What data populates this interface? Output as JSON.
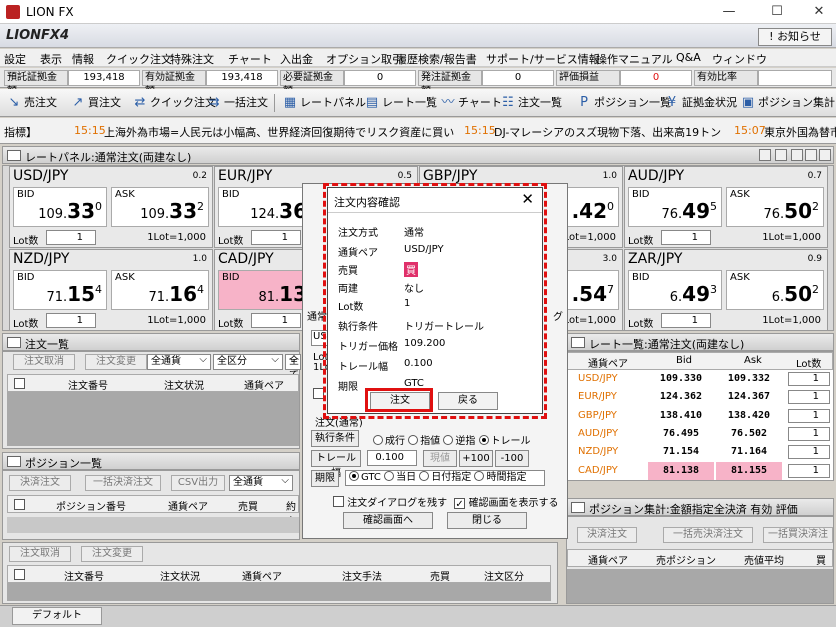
{
  "window": {
    "title": "LION FX",
    "min": "—",
    "max": "☐",
    "close": "✕"
  },
  "brand": {
    "name": "LIONFX4",
    "notice": "! お知らせ"
  },
  "menu": [
    "設定",
    "表示",
    "情報",
    "クイック注文",
    "特殊注文",
    "チャート",
    "入出金",
    "オプション取引",
    "履歴検索/報告書",
    "サポート/サービス情報",
    "操作マニュアル",
    "Q&A",
    "ウィンドウ"
  ],
  "status": [
    {
      "label": "預託証拠金額",
      "value": "193,418"
    },
    {
      "label": "有効証拠金額",
      "value": "193,418"
    },
    {
      "label": "必要証拠金額",
      "value": "0"
    },
    {
      "label": "発注証拠金額",
      "value": "0"
    },
    {
      "label": "評価損益",
      "value": "0"
    },
    {
      "label": "有効比率",
      "value": ""
    }
  ],
  "toolbar": [
    "売注文",
    "買注文",
    "クイック注文",
    "一括注文",
    "レートパネル",
    "レート一覧",
    "チャート",
    "注文一覧",
    "ポジション一覧",
    "証拠金状況",
    "ポジション集計"
  ],
  "ticker": {
    "prefix": "指標】",
    "items": [
      {
        "time": "15:15",
        "text": "上海外為市場=人民元は小幅高、世界経済回復期待でリスク資産に買い"
      },
      {
        "time": "15:15",
        "text": "DJ-マレーシアのスズ現物下落、出来高19トン"
      },
      {
        "time": "15:07",
        "text": "東京外国為替市"
      }
    ]
  },
  "rate_panel": {
    "title": "レートパネル:通常注文(両建なし)",
    "bid_label": "BID",
    "ask_label": "ASK",
    "lot_label": "Lot数",
    "lot_value": "1",
    "lot_unit": "1Lot=1,000",
    "pairs": [
      {
        "pair": "USD/JPY",
        "spread": "0.2",
        "bid_main": "109.",
        "bid_big": "33",
        "bid_small": "0",
        "ask_main": "109.",
        "ask_big": "33",
        "ask_small": "2"
      },
      {
        "pair": "EUR/JPY",
        "spread": "0.5",
        "bid_main": "124.",
        "bid_big": "36",
        "bid_small": "",
        "ask_main": "",
        "ask_big": "",
        "ask_small": ""
      },
      {
        "pair": "GBP/JPY",
        "spread": "1.0",
        "bid_main": "",
        "bid_big": "",
        "bid_small": "",
        "ask_main": "",
        "ask_big": ".42",
        "ask_small": "0"
      },
      {
        "pair": "AUD/JPY",
        "spread": "0.7",
        "bid_main": "76.",
        "bid_big": "49",
        "bid_small": "5",
        "ask_main": "76.",
        "ask_big": "50",
        "ask_small": "2"
      },
      {
        "pair": "NZD/JPY",
        "spread": "1.0",
        "bid_main": "71.",
        "bid_big": "15",
        "bid_small": "4",
        "ask_main": "71.",
        "ask_big": "16",
        "ask_small": "4"
      },
      {
        "pair": "CAD/JPY",
        "spread": "",
        "bid_main": "81.",
        "bid_big": "13",
        "bid_small": "",
        "ask_main": "",
        "ask_big": "",
        "ask_small": ""
      },
      {
        "pair": "",
        "spread": "3.0",
        "bid_main": "",
        "bid_big": "",
        "bid_small": "",
        "ask_main": "",
        "ask_big": ".54",
        "ask_small": "7"
      },
      {
        "pair": "ZAR/JPY",
        "spread": "0.9",
        "bid_main": "6.",
        "bid_big": "49",
        "bid_small": "3",
        "ask_main": "6.",
        "ask_big": "50",
        "ask_small": "2"
      }
    ]
  },
  "order_list": {
    "title": "注文一覧",
    "cancel": "注文取消",
    "change": "注文変更",
    "currency": "全通貨",
    "category": "全区分",
    "all": "全て",
    "cols": [
      "注文番号",
      "注文状況",
      "通貨ペア"
    ]
  },
  "position_list": {
    "title": "ポジション一覧",
    "close": "決済注文",
    "bulk_close": "一括決済注文",
    "csv": "CSV出力",
    "currency": "全通貨",
    "cols": [
      "ポジション番号",
      "通貨ペア",
      "売買",
      "約定"
    ]
  },
  "bottom_list": {
    "cancel": "注文取消",
    "change": "注文変更",
    "cols": [
      "注文番号",
      "注文状況",
      "通貨ペア",
      "注文手法",
      "売買",
      "注文区分"
    ]
  },
  "rate_list": {
    "title": "レート一覧:通常注文(両建なし)",
    "cols": [
      "通貨ペア",
      "Bid",
      "Ask",
      "Lot数"
    ],
    "rows": [
      {
        "pair": "USD/JPY",
        "bid": "109.330",
        "ask": "109.332",
        "lot": "1"
      },
      {
        "pair": "EUR/JPY",
        "bid": "124.362",
        "ask": "124.367",
        "lot": "1"
      },
      {
        "pair": "GBP/JPY",
        "bid": "138.410",
        "ask": "138.420",
        "lot": "1"
      },
      {
        "pair": "AUD/JPY",
        "bid": "76.495",
        "ask": "76.502",
        "lot": "1"
      },
      {
        "pair": "NZD/JPY",
        "bid": "71.154",
        "ask": "71.164",
        "lot": "1"
      },
      {
        "pair": "CAD/JPY",
        "bid": "81.138",
        "ask": "81.155",
        "lot": "1"
      }
    ]
  },
  "pos_summary": {
    "title": "ポジション集計:金額指定全決済 有効 評価",
    "close": "決済注文",
    "bulk": "一括売決済注文",
    "bulk2": "一括買決済注",
    "cols": [
      "通貨ペア",
      "売ポジション",
      "売値平均",
      "買"
    ]
  },
  "order_dialog": {
    "tab": "通常",
    "pair_short": "US",
    "lot_short": "Lot",
    "lot2_short": "1Lo",
    "right_short": "グ",
    "section": "注文(通常)",
    "exec_label": "執行条件",
    "exec_opts": [
      "成行",
      "指値",
      "逆指",
      "トレール"
    ],
    "trail_label": "トレール幅",
    "trail_value": "0.100",
    "current": "現値",
    "plus": "+100",
    "minus": "-100",
    "period_label": "期限",
    "period_opts": [
      "GTC",
      "当日",
      "日付指定",
      "時間指定"
    ],
    "leave_dialog": "注文ダイアログを残す",
    "show_confirm": "確認画面を表示する",
    "to_confirm": "確認画面へ",
    "close": "閉じる"
  },
  "confirm": {
    "title": "注文内容確認",
    "close": "✕",
    "rows": [
      {
        "k": "注文方式",
        "v": "通常"
      },
      {
        "k": "通貨ペア",
        "v": "USD/JPY"
      },
      {
        "k": "売買",
        "v": "買"
      },
      {
        "k": "両建",
        "v": "なし"
      },
      {
        "k": "Lot数",
        "v": "1"
      },
      {
        "k": "執行条件",
        "v": "トリガートレール"
      },
      {
        "k": "トリガー価格",
        "v": "109.200"
      },
      {
        "k": "トレール幅",
        "v": "0.100"
      },
      {
        "k": "期限",
        "v": "GTC"
      }
    ],
    "order": "注文",
    "back": "戻る"
  },
  "footer": {
    "tab": "デフォルト"
  },
  "colors": {
    "accent_red": "#e01010",
    "pink": "#f7b3c8",
    "orange": "#e07000"
  }
}
